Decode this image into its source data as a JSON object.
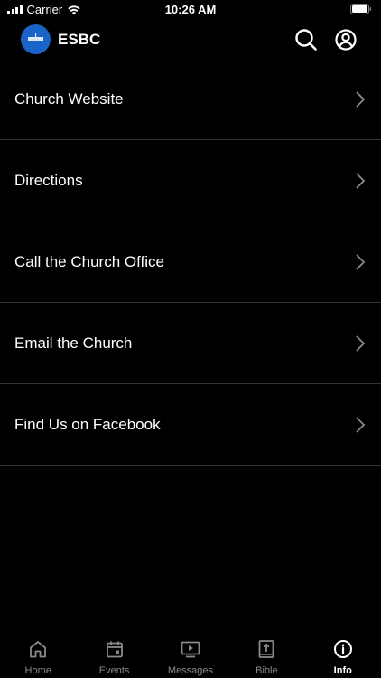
{
  "status_bar": {
    "carrier": "Carrier",
    "time": "10:26 AM"
  },
  "header": {
    "title": "ESBC"
  },
  "menu": {
    "items": [
      {
        "label": "Church Website"
      },
      {
        "label": "Directions"
      },
      {
        "label": "Call the Church Office"
      },
      {
        "label": "Email the Church"
      },
      {
        "label": "Find Us on Facebook"
      }
    ]
  },
  "tabs": [
    {
      "label": "Home",
      "icon": "home-icon"
    },
    {
      "label": "Events",
      "icon": "calendar-icon"
    },
    {
      "label": "Messages",
      "icon": "play-screen-icon"
    },
    {
      "label": "Bible",
      "icon": "bible-icon"
    },
    {
      "label": "Info",
      "icon": "info-icon",
      "active": true
    }
  ],
  "colors": {
    "background": "#000000",
    "divider": "#333333",
    "inactive_tab": "#8a8a8a",
    "active_tab": "#ffffff",
    "logo_blue": "#1a64c8"
  }
}
